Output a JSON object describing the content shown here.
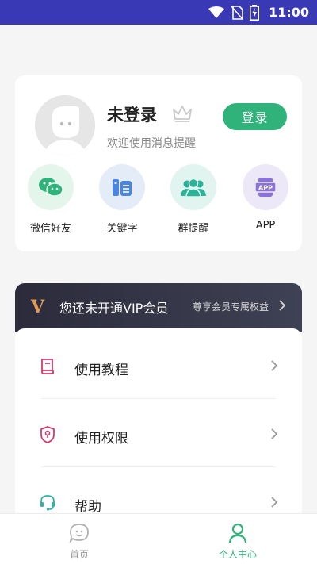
{
  "status_bar": {
    "time": "11:00",
    "bg": "#3a39b5"
  },
  "profile": {
    "name": "未登录",
    "welcome": "欢迎使用消息提醒",
    "login_label": "登录"
  },
  "quick_actions": [
    {
      "label": "微信好友",
      "icon": "wechat-icon"
    },
    {
      "label": "关键字",
      "icon": "keyword-icon"
    },
    {
      "label": "群提醒",
      "icon": "group-icon"
    },
    {
      "label": "APP",
      "icon": "app-icon",
      "icon_text": "APP"
    }
  ],
  "vip": {
    "logo": "V",
    "title": "您还未开通VIP会员",
    "subtitle": "尊享会员专属权益"
  },
  "menu": [
    {
      "label": "使用教程",
      "icon": "tutorial-book-icon"
    },
    {
      "label": "使用权限",
      "icon": "permission-shield-icon"
    },
    {
      "label": "帮助",
      "icon": "headset-help-icon"
    }
  ],
  "tabs": [
    {
      "label": "首页",
      "icon": "home-chat-icon",
      "active": false
    },
    {
      "label": "个人中心",
      "icon": "profile-person-icon",
      "active": true
    }
  ],
  "colors": {
    "accent": "#2fb37a",
    "vip_gold": "#e09a56",
    "menu_icon": "#d63a6c",
    "help_icon": "#2bb3a4"
  }
}
